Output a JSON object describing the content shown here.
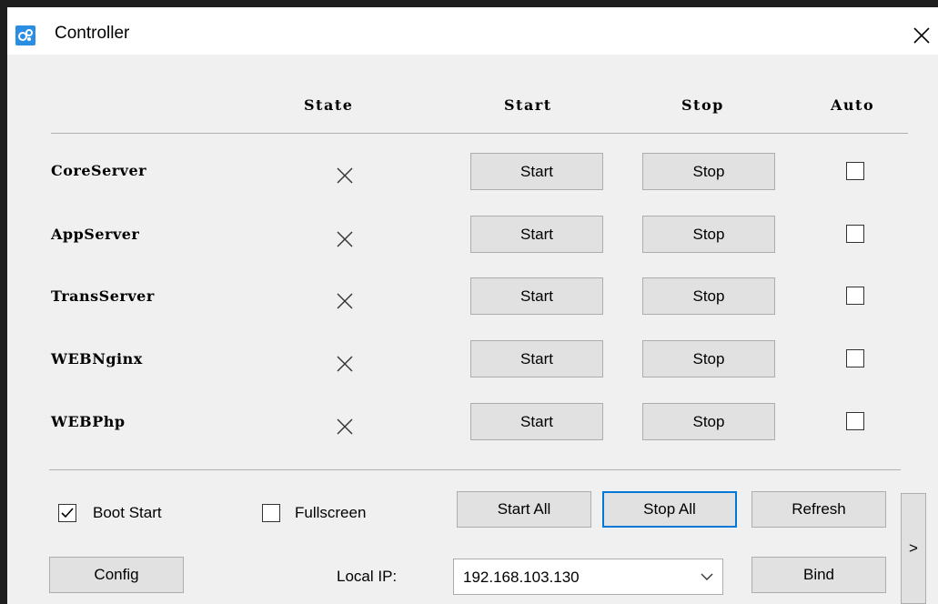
{
  "window": {
    "title": "Controller",
    "accent_color": "#0078d7"
  },
  "table": {
    "headers": [
      "State",
      "Start",
      "Stop",
      "Auto"
    ],
    "rows": [
      {
        "name": "CoreServer",
        "state": "×",
        "start": "Start",
        "stop": "Stop",
        "auto": false
      },
      {
        "name": "AppServer",
        "state": "×",
        "start": "Start",
        "stop": "Stop",
        "auto": false
      },
      {
        "name": "TransServer",
        "state": "×",
        "start": "Start",
        "stop": "Stop",
        "auto": false
      },
      {
        "name": "WEBNginx",
        "state": "×",
        "start": "Start",
        "stop": "Stop",
        "auto": false
      },
      {
        "name": "WEBPhp",
        "state": "×",
        "start": "Start",
        "stop": "Stop",
        "auto": false
      }
    ]
  },
  "footer": {
    "boot_start": {
      "label": "Boot Start",
      "checked": true
    },
    "fullscreen": {
      "label": "Fullscreen",
      "checked": false
    },
    "start_all": "Start All",
    "stop_all": "Stop All",
    "refresh": "Refresh",
    "config": "Config",
    "local_ip_label": "Local IP:",
    "local_ip_value": "192.168.103.130",
    "bind": "Bind",
    "expand": ">"
  },
  "icons": {
    "app": "app-logo-icon",
    "close": "close-icon",
    "state": "x-mark-icon",
    "dropdown": "chevron-down-icon"
  }
}
